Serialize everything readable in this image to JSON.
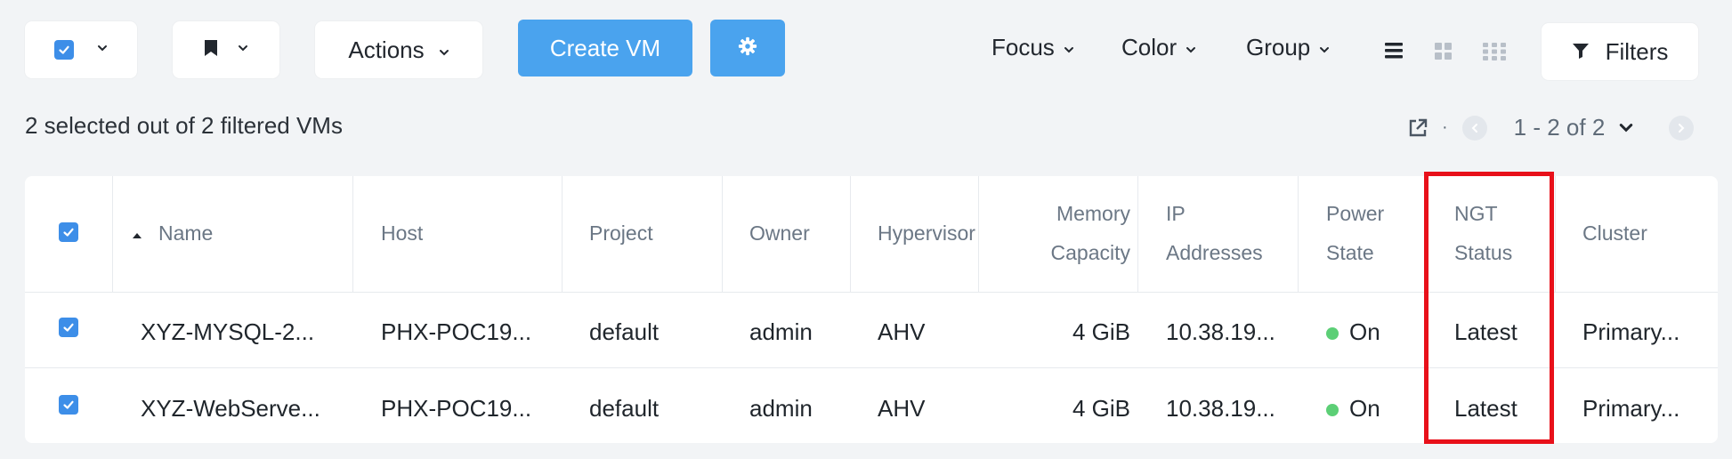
{
  "toolbar": {
    "actions_label": "Actions",
    "create_vm_label": "Create VM",
    "focus_label": "Focus",
    "color_label": "Color",
    "group_label": "Group",
    "filters_label": "Filters"
  },
  "summary_text": "2 selected out of 2 filtered VMs",
  "pager": {
    "range_text": "1 - 2 of 2",
    "separator": "·"
  },
  "table": {
    "headers": {
      "name": "Name",
      "host": "Host",
      "project": "Project",
      "owner": "Owner",
      "hypervisor": "Hypervisor",
      "memory_line1": "Memory",
      "memory_line2": "Capacity",
      "ip_line1": "IP",
      "ip_line2": "Addresses",
      "power_line1": "Power",
      "power_line2": "State",
      "ngt_line1": "NGT",
      "ngt_line2": "Status",
      "cluster": "Cluster"
    },
    "rows": [
      {
        "name": "XYZ-MYSQL-2...",
        "host": "PHX-POC19...",
        "project": "default",
        "owner": "admin",
        "hypervisor": "AHV",
        "memory": "4 GiB",
        "ip": "10.38.19...",
        "power": "On",
        "ngt": "Latest",
        "cluster": "Primary..."
      },
      {
        "name": "XYZ-WebServe...",
        "host": "PHX-POC19...",
        "project": "default",
        "owner": "admin",
        "hypervisor": "AHV",
        "memory": "4 GiB",
        "ip": "10.38.19...",
        "power": "On",
        "ngt": "Latest",
        "cluster": "Primary..."
      }
    ]
  },
  "colors": {
    "primary": "#4aa3ee",
    "checkbox": "#3d8ee8",
    "power_on": "#5ccf76",
    "highlight": "#e8101a"
  }
}
